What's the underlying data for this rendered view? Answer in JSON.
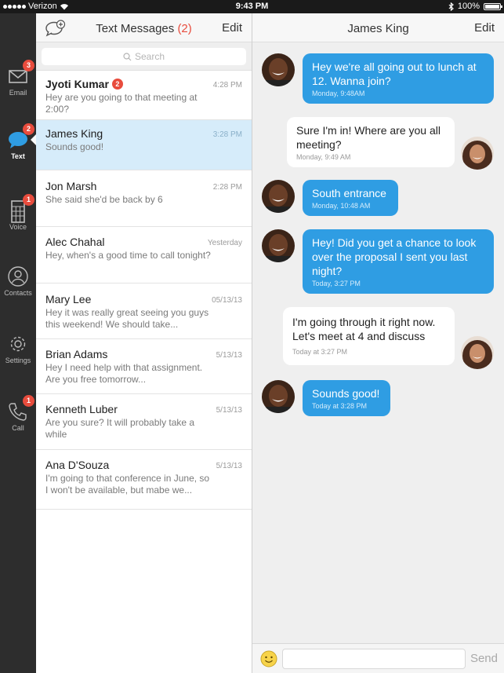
{
  "status_bar": {
    "carrier": "Verizon",
    "time": "9:43 PM",
    "battery": "100%"
  },
  "rail": {
    "items": [
      {
        "label": "Email",
        "icon": "mail-icon",
        "badge": "3"
      },
      {
        "label": "Text",
        "icon": "chat-bubble-icon",
        "badge": "2",
        "active": true
      },
      {
        "label": "Voice",
        "icon": "keypad-icon",
        "badge": "1"
      },
      {
        "label": "Contacts",
        "icon": "person-icon",
        "badge": ""
      },
      {
        "label": "Settings",
        "icon": "gear-icon",
        "badge": ""
      },
      {
        "label": "Call",
        "icon": "phone-icon",
        "badge": "1"
      }
    ]
  },
  "list": {
    "title": "Text Messages",
    "title_count": "(2)",
    "edit_label": "Edit",
    "search_placeholder": "Search",
    "conversations": [
      {
        "name": "Jyoti Kumar",
        "badge": "2",
        "date": "4:28 PM",
        "snippet": "Hey are you going to that meeting at 2:00?"
      },
      {
        "name": "James King",
        "badge": "",
        "date": "3:28 PM",
        "snippet": "Sounds good!"
      },
      {
        "name": "Jon Marsh",
        "badge": "",
        "date": "2:28 PM",
        "snippet": "She said she'd be back by 6"
      },
      {
        "name": "Alec Chahal",
        "badge": "",
        "date": "Yesterday",
        "snippet": "Hey, when's a good time to call tonight?"
      },
      {
        "name": "Mary Lee",
        "badge": "",
        "date": "05/13/13",
        "snippet": "Hey it was really great seeing you guys this weekend! We should take..."
      },
      {
        "name": "Brian Adams",
        "badge": "",
        "date": "5/13/13",
        "snippet": "Hey I need help with that assignment. Are you free tomorrow..."
      },
      {
        "name": "Kenneth Luber",
        "badge": "",
        "date": "5/13/13",
        "snippet": "Are you sure? It will probably take a while"
      },
      {
        "name": "Ana D'Souza",
        "badge": "",
        "date": "5/13/13",
        "snippet": "I'm going to that conference in June, so I won't be available, but mabe we..."
      }
    ]
  },
  "chat": {
    "title": "James King",
    "edit_label": "Edit",
    "messages": [
      {
        "dir": "out",
        "text": "Hey we're all going out to lunch at 12. Wanna join?",
        "time": "Monday, 9:48AM"
      },
      {
        "dir": "in",
        "text": "Sure I'm in! Where are you all meeting?",
        "time": "Monday, 9:49 AM"
      },
      {
        "dir": "out",
        "text": "South entrance",
        "time": "Monday, 10:48 AM"
      },
      {
        "dir": "out",
        "text": "Hey! Did you get a chance to look over the proposal I sent you last night?",
        "time": "Today, 3:27 PM"
      },
      {
        "dir": "in",
        "text": "I'm going through it right now. Let's meet at 4 and discuss",
        "time": "Today at 3:27 PM"
      },
      {
        "dir": "out",
        "text": "Sounds good!",
        "time": "Today at 3:28 PM"
      }
    ],
    "composer": {
      "placeholder": "",
      "send_label": "Send"
    }
  },
  "colors": {
    "accent": "#2f9de3",
    "badge": "#e84c3d",
    "rail": "#2d2d2d",
    "selected_row": "#d6ecfa"
  }
}
